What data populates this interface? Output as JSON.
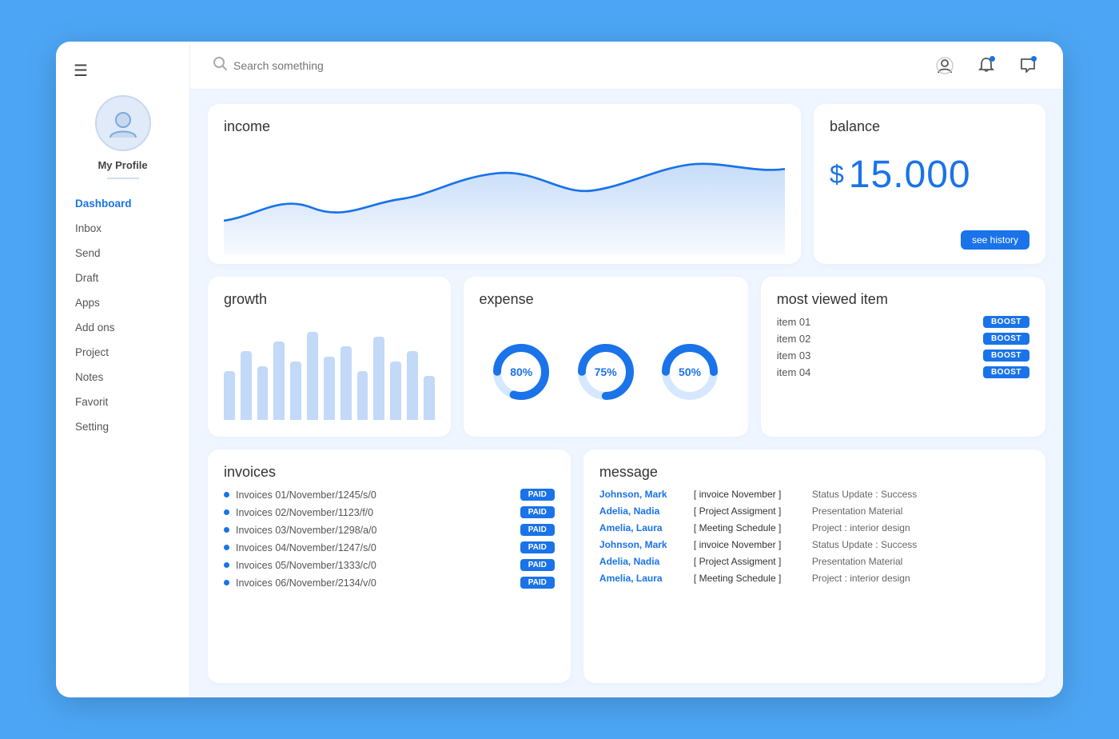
{
  "sidebar": {
    "menu_icon": "☰",
    "profile_name": "My Profile",
    "nav_items": [
      {
        "label": "Dashboard",
        "active": true
      },
      {
        "label": "Inbox"
      },
      {
        "label": "Send"
      },
      {
        "label": "Draft"
      },
      {
        "label": "Apps"
      },
      {
        "label": "Add ons"
      },
      {
        "label": "Project"
      },
      {
        "label": "Notes"
      },
      {
        "label": "Favorit"
      },
      {
        "label": "Setting"
      }
    ]
  },
  "header": {
    "search_placeholder": "Search something",
    "icons": [
      "user-icon",
      "bell-icon",
      "chat-icon"
    ]
  },
  "income": {
    "title": "income",
    "chart_data": [
      30,
      45,
      35,
      50,
      40,
      55,
      70,
      55,
      65,
      80,
      70,
      85,
      75
    ]
  },
  "balance": {
    "title": "balance",
    "currency_symbol": "$",
    "amount": "15.000",
    "button_label": "see history"
  },
  "growth": {
    "title": "growth",
    "bars": [
      50,
      70,
      55,
      80,
      60,
      90,
      65,
      75,
      50,
      85,
      60,
      70,
      45
    ]
  },
  "expense": {
    "title": "expense",
    "items": [
      {
        "percent": 80,
        "label": "80%"
      },
      {
        "percent": 75,
        "label": "75%"
      },
      {
        "percent": 50,
        "label": "50%"
      }
    ]
  },
  "most_viewed": {
    "title": "most viewed item",
    "items": [
      {
        "name": "item 01",
        "button": "BOOST"
      },
      {
        "name": "item 02",
        "button": "BOOST"
      },
      {
        "name": "item 03",
        "button": "BOOST"
      },
      {
        "name": "item 04",
        "button": "BOOST"
      }
    ]
  },
  "invoices": {
    "title": "invoices",
    "items": [
      {
        "text": "Invoices 01/November/1245/s/0",
        "status": "PAID"
      },
      {
        "text": "Invoices 02/November/1123/f/0",
        "status": "PAID"
      },
      {
        "text": "Invoices 03/November/1298/a/0",
        "status": "PAID"
      },
      {
        "text": "Invoices 04/November/1247/s/0",
        "status": "PAID"
      },
      {
        "text": "Invoices 05/November/1333/c/0",
        "status": "PAID"
      },
      {
        "text": "Invoices 06/November/2134/v/0",
        "status": "PAID"
      }
    ]
  },
  "message": {
    "title": "message",
    "items": [
      {
        "name": "Johnson, Mark",
        "subject": "[ invoice November ]",
        "preview": "Status Update : Success"
      },
      {
        "name": "Adelia, Nadia",
        "subject": "[ Project Assigment ]",
        "preview": "Presentation Material"
      },
      {
        "name": "Amelia, Laura",
        "subject": "[ Meeting Schedule ]",
        "preview": "Project : interior design"
      },
      {
        "name": "Johnson, Mark",
        "subject": "[ invoice November ]",
        "preview": "Status Update : Success"
      },
      {
        "name": "Adelia, Nadia",
        "subject": "[ Project Assigment ]",
        "preview": "Presentation Material"
      },
      {
        "name": "Amelia, Laura",
        "subject": "[ Meeting Schedule ]",
        "preview": "Project : interior design"
      }
    ]
  }
}
